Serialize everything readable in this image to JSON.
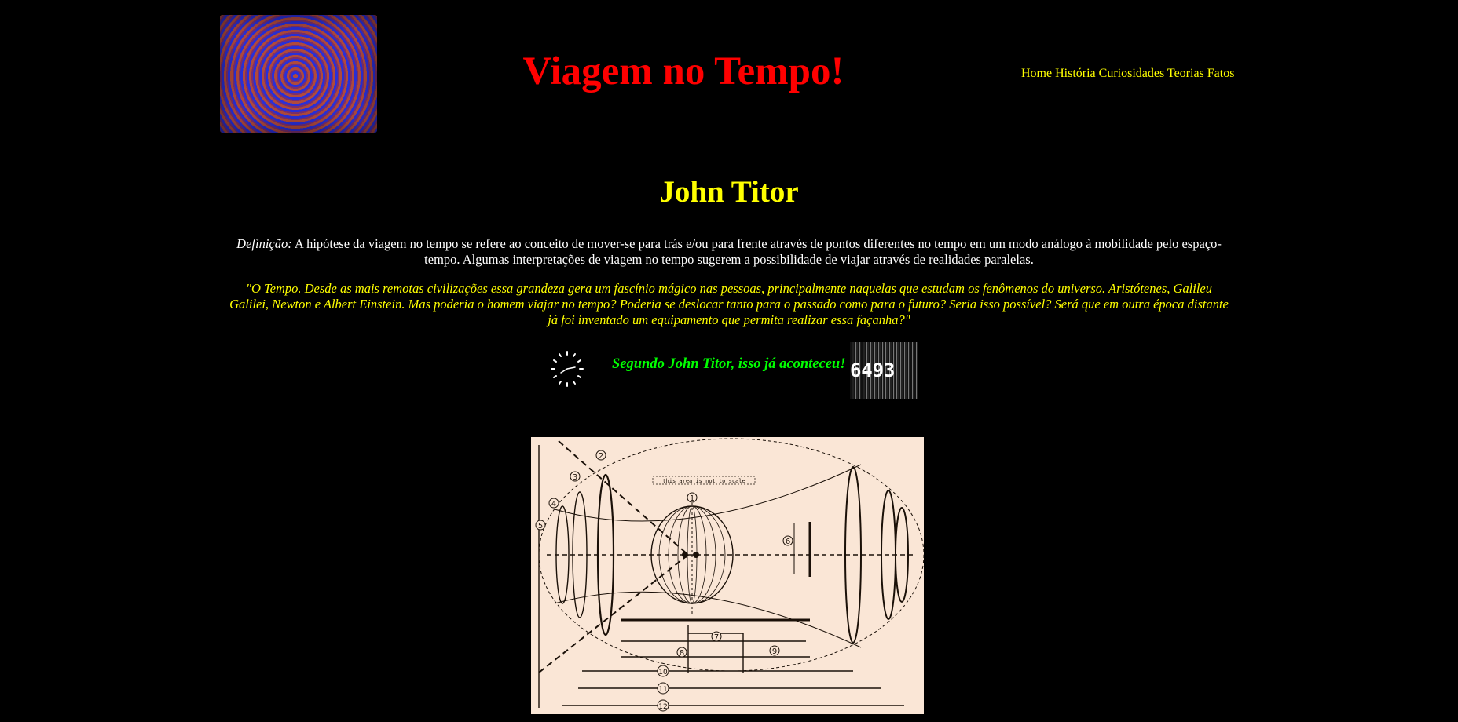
{
  "header": {
    "title": "Viagem no Tempo!",
    "logo_icon": "tunnel-spiral-image"
  },
  "nav": {
    "items": [
      {
        "label": "Home"
      },
      {
        "label": "História"
      },
      {
        "label": "Curiosidades"
      },
      {
        "label": "Teorias"
      },
      {
        "label": "Fatos"
      }
    ]
  },
  "main": {
    "heading": "John Titor",
    "definition_label": "Definição:",
    "definition_text": " A hipótese da viagem no tempo se refere ao conceito de mover-se para trás e/ou para frente através de pontos diferentes no tempo em um modo análogo à mobilidade pelo espaço-tempo. Algumas interpretações de viagem no tempo sugerem a possibilidade de viajar através de realidades paralelas.",
    "quote": "\"O Tempo. Desde as mais remotas civilizações essa grandeza gera um fascínio mágico nas pessoas, principalmente naquelas que estudam os fenômenos do universo. Aristótenes, Galileu Galilei, Newton e Albert Einstein. Mas poderia o homem viajar no tempo? Poderia se deslocar tanto para o passado como para o futuro? Seria isso possível? Será que em outra época distante já foi inventado um equipamento que permita realizar essa façanha?\"",
    "tagline": "Segundo John Titor, isso já aconteceu!",
    "clock_icon": "clock-icon",
    "counter": [
      "6",
      "4",
      "9",
      "3",
      "",
      ""
    ]
  },
  "diagram": {
    "caption_text": "this area is not to scale",
    "labels": [
      "1",
      "2",
      "3",
      "4",
      "5",
      "6",
      "7",
      "8",
      "9",
      "10",
      "11",
      "12"
    ]
  },
  "colors": {
    "background": "#000000",
    "title": "#ff0000",
    "heading": "#ffff00",
    "links": "#ffff00",
    "quote": "#ffff00",
    "tagline": "#00ff00",
    "diagram_bg": "#fae6d6"
  }
}
